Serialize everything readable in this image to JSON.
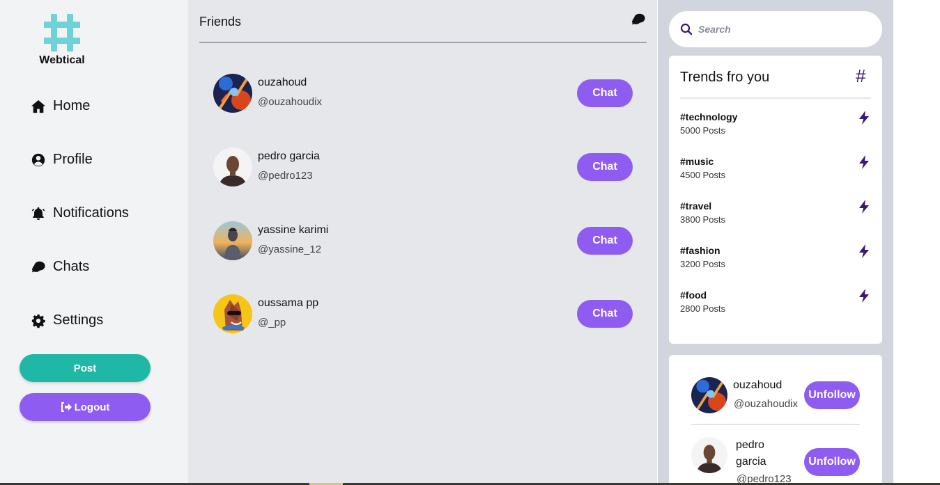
{
  "brand": {
    "name": "Webtical",
    "color": "#6dd3d8"
  },
  "nav": {
    "items": [
      {
        "label": "Home",
        "icon": "home-icon"
      },
      {
        "label": "Profile",
        "icon": "user-circle-icon"
      },
      {
        "label": "Notifications",
        "icon": "bell-icon"
      },
      {
        "label": "Chats",
        "icon": "chat-bubbles-icon"
      },
      {
        "label": "Settings",
        "icon": "gear-icon"
      }
    ],
    "post_label": "Post",
    "logout_label": "Logout"
  },
  "main": {
    "title": "Friends",
    "chat_label": "Chat",
    "friends": [
      {
        "name": "ouzahoud",
        "handle": "@ouzahoudix"
      },
      {
        "name": "pedro garcia",
        "handle": "@pedro123"
      },
      {
        "name": "yassine karimi",
        "handle": "@yassine_12"
      },
      {
        "name": "oussama pp",
        "handle": "@_pp"
      }
    ]
  },
  "search": {
    "placeholder": "Search"
  },
  "trends": {
    "title": "Trends fro you",
    "hash_symbol": "#",
    "items": [
      {
        "tag": "#technology",
        "count": "5000 Posts"
      },
      {
        "tag": "#music",
        "count": "4500 Posts"
      },
      {
        "tag": "#travel",
        "count": "3800 Posts"
      },
      {
        "tag": "#fashion",
        "count": "3200 Posts"
      },
      {
        "tag": "#food",
        "count": "2800 Posts"
      }
    ]
  },
  "follows": {
    "unfollow_label": "Unfollow",
    "items": [
      {
        "name": "ouzahoud",
        "handle": "@ouzahoudix"
      },
      {
        "name": "pedro garcia",
        "handle": "@pedro123"
      }
    ]
  },
  "colors": {
    "accent": "#8f5cf2",
    "post": "#1fb7a6",
    "trend_icon": "#3b1878"
  }
}
